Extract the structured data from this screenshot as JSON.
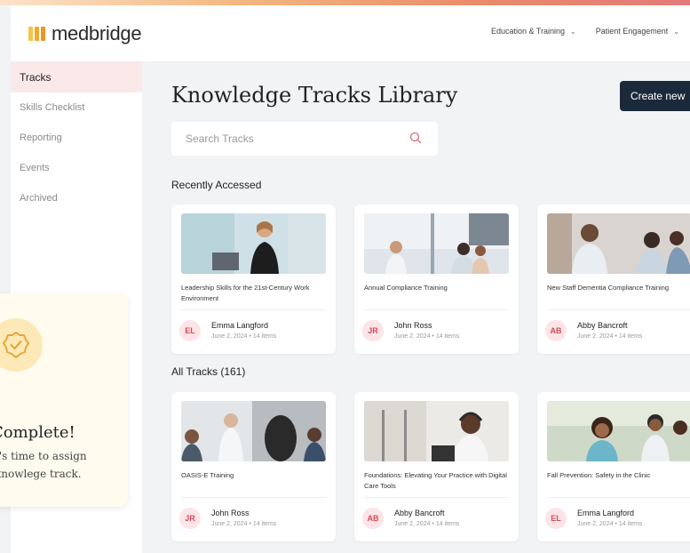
{
  "brand": {
    "name": "medbridge"
  },
  "topnav": [
    {
      "label": "Education & Training"
    },
    {
      "label": "Patient Engagement"
    }
  ],
  "sidebar": {
    "items": [
      {
        "label": "Tracks",
        "active": true
      },
      {
        "label": "Skills Checklist"
      },
      {
        "label": "Reporting"
      },
      {
        "label": "Events"
      },
      {
        "label": "Archived"
      }
    ]
  },
  "complete": {
    "title": "Complete!",
    "line1": "t's time to assign",
    "line2": "knowlege track."
  },
  "main": {
    "title": "Knowledge Tracks Library",
    "create_label": "Create new",
    "search_placeholder": "Search Tracks",
    "recent_label": "Recently Accessed",
    "all_label": "All Tracks (161)"
  },
  "recent": [
    {
      "title": "Leadership Skills for the 21st-Century Work Environment",
      "initials": "EL",
      "author": "Emma Langford",
      "meta": "June 2, 2024 • 14 items"
    },
    {
      "title": "Annual Compliance Training",
      "initials": "JR",
      "author": "John Ross",
      "meta": "June 2, 2024 • 14 items"
    },
    {
      "title": "New Staff Dementia Compliance Training",
      "initials": "AB",
      "author": "Abby Bancroft",
      "meta": "June 2, 2024 • 14 items"
    }
  ],
  "all": [
    {
      "title": "OASIS-E Training",
      "initials": "JR",
      "author": "John Ross",
      "meta": "June 2, 2024 • 14 items"
    },
    {
      "title": "Foundations: Elevating Your Practice with Digital Care Tools",
      "initials": "AB",
      "author": "Abby Bancroft",
      "meta": "June 2, 2024 • 14 items"
    },
    {
      "title": "Fall Prevention: Safety in the Clinic",
      "initials": "EL",
      "author": "Emma Langford",
      "meta": "June 2, 2024 • 14 items"
    }
  ],
  "colors": {
    "primary_button": "#1b2a3a",
    "active_nav": "#fbe9ea",
    "avatar_text": "#d64a5a",
    "badge": "#fde9b8"
  }
}
